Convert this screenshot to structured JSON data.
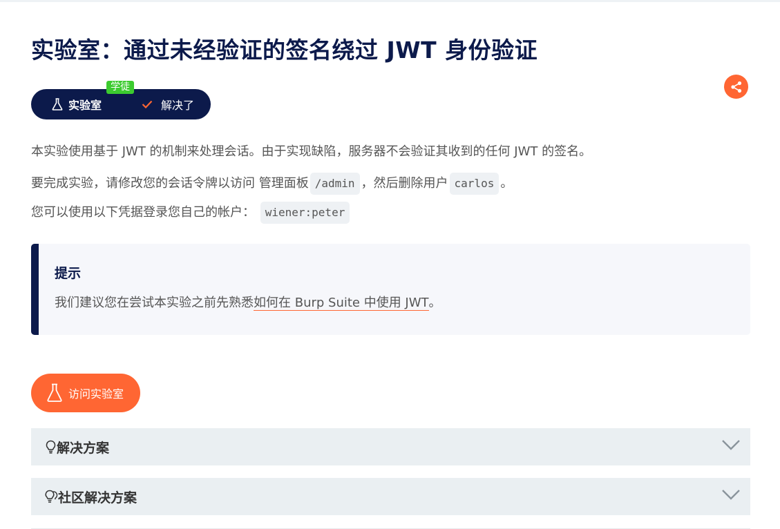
{
  "lab": {
    "title": "实验室：通过未经验证的签名绕过 JWT 身份验证",
    "badge_label": "实验室",
    "level": "学徒",
    "status": "解决了"
  },
  "description": {
    "p1": "本实验使用基于 JWT 的机制来处理会话。由于实现缺陷，服务器不会验证其收到的任何 JWT 的签名。",
    "p2_before": "要完成实验，请修改您的会话令牌以访问 管理面板",
    "p2_code1": "/admin",
    "p2_middle": "，然后删除用户",
    "p2_code2": "carlos",
    "p2_after": "。",
    "p3_before": "您可以使用以下凭据登录您自己的帐户：",
    "p3_code": "wiener:peter"
  },
  "hint": {
    "title": "提示",
    "text_before": "我们建议您在尝试本实验之前先熟悉",
    "link": "如何在 Burp Suite 中使用 JWT",
    "text_after": "。"
  },
  "access_button": "访问实验室",
  "accordions": [
    {
      "label": "解决方案",
      "icon": "lightbulb-icon"
    },
    {
      "label": "社区解决方案",
      "icon": "double-lightbulb-icon"
    }
  ],
  "colors": {
    "navy": "#0c1a4b",
    "accent": "#ff6633",
    "level_green": "#3ccb2f"
  }
}
